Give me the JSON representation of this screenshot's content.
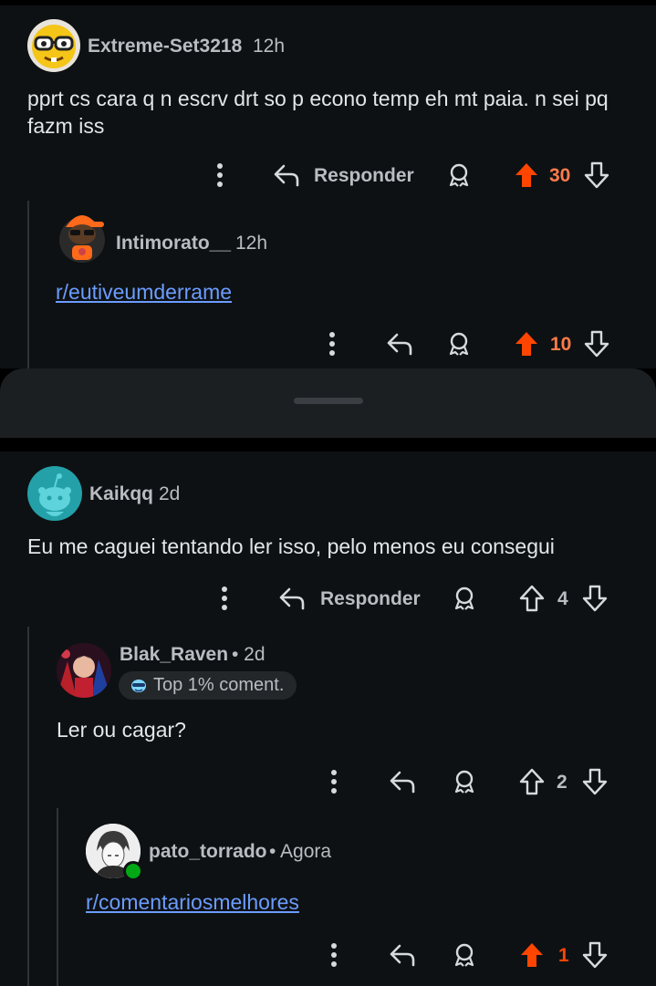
{
  "colors": {
    "background": "#0e1113",
    "text": "#e3e6e8",
    "meta": "#b8bdc1",
    "link": "#6b9cff",
    "upvote": "#ff4500",
    "online": "#01a816"
  },
  "comment1": {
    "username": "Extreme-Set3218",
    "time": "12h",
    "body": "pprt cs cara q n escrv drt so p econo temp eh mt paia. n sei pq fazm iss",
    "reply_label": "Responder",
    "score": "30",
    "avatar_icon": "nerd-face-avatar-icon"
  },
  "comment1_reply": {
    "username": "Intimorato__",
    "time": "12h",
    "link": "r/eutiveumderrame",
    "score": "10",
    "avatar_icon": "snoo-cap-avatar-icon"
  },
  "comment2": {
    "username": "Kaikqq",
    "time": "2d",
    "body": "Eu me caguei tentando ler isso, pelo menos eu consegui",
    "reply_label": "Responder",
    "score": "4",
    "avatar_icon": "default-snoo-avatar-icon"
  },
  "comment2_reply": {
    "username": "Blak_Raven",
    "time": "• 2d",
    "badge": "Top 1% coment.",
    "body": "Ler ou cagar?",
    "score": "2",
    "avatar_icon": "anime-avatar-icon"
  },
  "comment2_reply_reply": {
    "username": "pato_torrado",
    "time": "• Agora",
    "link": "r/comentariosmelhores",
    "score": "1",
    "avatar_icon": "anime-sketch-avatar-icon"
  }
}
